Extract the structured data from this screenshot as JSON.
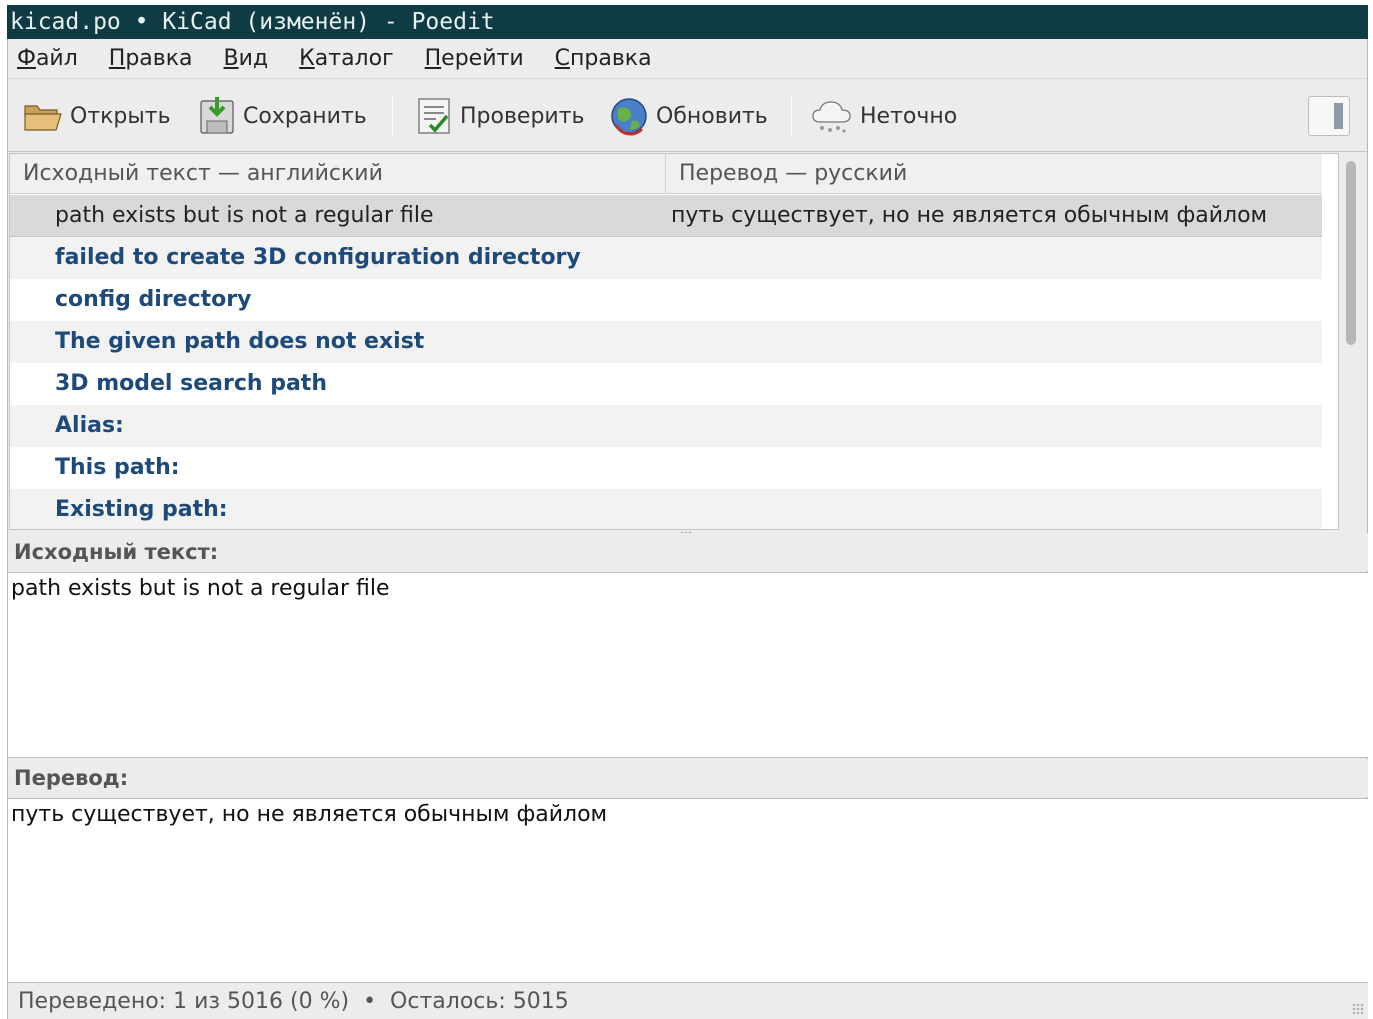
{
  "window": {
    "title": "kicad.po • KiCad (изменён) - Poedit"
  },
  "menu": [
    {
      "mnemonic": "Ф",
      "rest": "айл"
    },
    {
      "mnemonic": "П",
      "rest": "равка"
    },
    {
      "mnemonic": "В",
      "rest": "ид"
    },
    {
      "mnemonic": "К",
      "rest": "аталог"
    },
    {
      "mnemonic": "П",
      "rest": "ерейти"
    },
    {
      "mnemonic": "С",
      "rest": "правка"
    }
  ],
  "toolbar": {
    "open_label": "Открыть",
    "save_label": "Сохранить",
    "validate_label": "Проверить",
    "update_label": "Обновить",
    "fuzzy_label": "Неточно",
    "icons": {
      "open": "folder-open-icon",
      "save": "save-icon",
      "validate": "validate-checklist-icon",
      "update": "update-globe-icon",
      "fuzzy": "fuzzy-cloud-icon",
      "sidebar": "sidebar-toggle-icon"
    }
  },
  "list": {
    "headers": {
      "source": "Исходный текст — английский",
      "translation": "Перевод — русский"
    },
    "rows": [
      {
        "source": "path exists but is not a regular file",
        "translation": "путь существует, но не является обычным файлом",
        "state": "selected"
      },
      {
        "source": "failed to create 3D configuration directory",
        "translation": "",
        "state": "untranslated"
      },
      {
        "source": "config directory",
        "translation": "",
        "state": "untranslated"
      },
      {
        "source": "The given path does not exist",
        "translation": "",
        "state": "untranslated"
      },
      {
        "source": "3D model search path",
        "translation": "",
        "state": "untranslated"
      },
      {
        "source": "Alias:",
        "translation": "",
        "state": "untranslated"
      },
      {
        "source": "This path:",
        "translation": "",
        "state": "untranslated"
      },
      {
        "source": "Existing path:",
        "translation": "",
        "state": "untranslated"
      }
    ]
  },
  "source_panel": {
    "label": "Исходный текст:",
    "text": "path exists but is not a regular file"
  },
  "translation_panel": {
    "label": "Перевод:",
    "text": "путь существует, но не является обычным файлом"
  },
  "status": {
    "text": "Переведено: 1 из 5016 (0 %)  •  Осталось: 5015"
  },
  "colors": {
    "titlebar_bg": "#0f3b45",
    "untranslated_text": "#1e4a7a",
    "selected_row_bg": "#d9d9d9",
    "alt_row_bg": "#f2f2f2"
  }
}
